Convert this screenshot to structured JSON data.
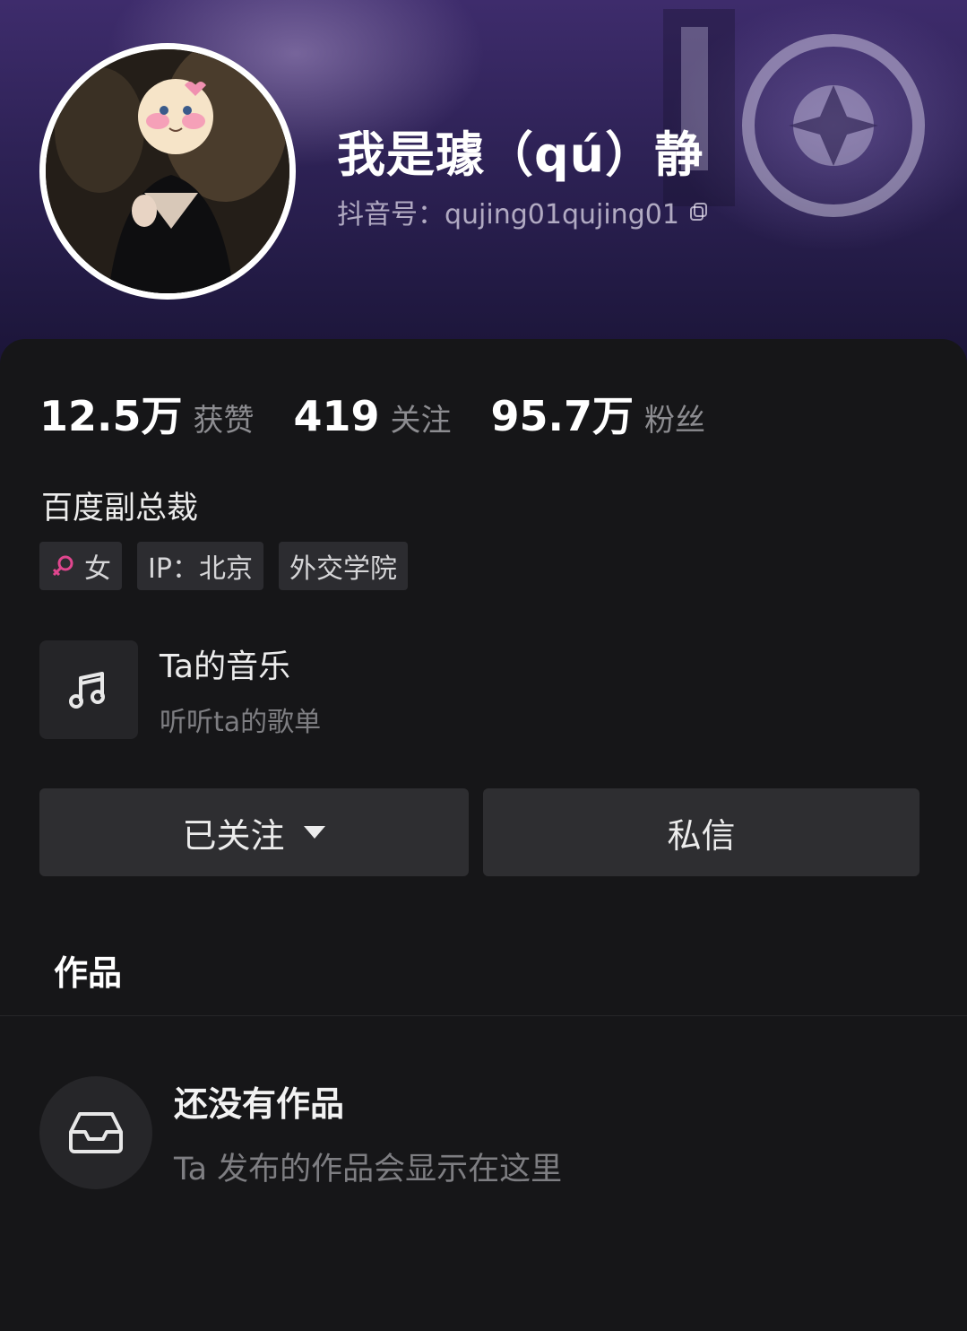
{
  "profile": {
    "nickname": "我是璩（qú）静",
    "douyin_id": "抖音号：qujing01qujing01",
    "avatar": "avatar-photo"
  },
  "stats": [
    {
      "value": "12.5万",
      "label": "获赞"
    },
    {
      "value": "419",
      "label": "关注"
    },
    {
      "value": "95.7万",
      "label": "粉丝"
    }
  ],
  "bio": "百度副总裁",
  "tags": {
    "gender": "女",
    "ip": "IP：北京",
    "school": "外交学院"
  },
  "music": {
    "title": "Ta的音乐",
    "subtitle": "听听ta的歌单",
    "icon": "music-note-icon"
  },
  "actions": {
    "follow_label": "已关注",
    "message_label": "私信"
  },
  "tabs": {
    "works_label": "作品"
  },
  "empty_state": {
    "title": "还没有作品",
    "subtitle": "Ta 发布的作品会显示在这里",
    "icon": "inbox-tray-icon"
  },
  "colors": {
    "background": "#161618",
    "button": "#2e2e31",
    "tag": "#2c2c30",
    "gender_female": "#e0468e",
    "banner": "#2e2256"
  }
}
